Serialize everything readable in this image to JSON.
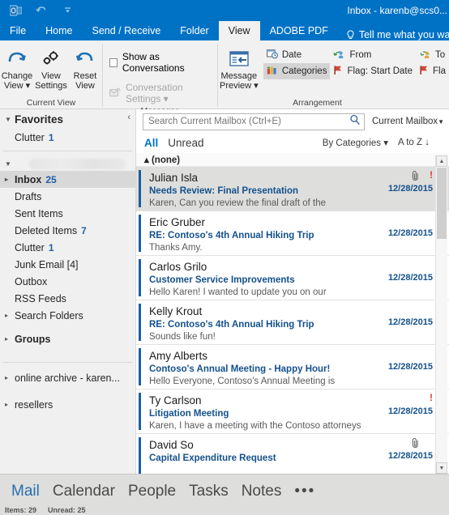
{
  "window": {
    "title": "Inbox - karenb@scs0...",
    "quick_access": [
      "outlook-logo-icon",
      "undo-icon",
      "customize-qat-icon"
    ]
  },
  "ribbon": {
    "tabs": [
      {
        "label": "File",
        "active": false
      },
      {
        "label": "Home",
        "active": false
      },
      {
        "label": "Send / Receive",
        "active": false
      },
      {
        "label": "Folder",
        "active": false
      },
      {
        "label": "View",
        "active": true
      },
      {
        "label": "ADOBE PDF",
        "active": false
      }
    ],
    "tell_me": "Tell me what you want to do",
    "groups": [
      {
        "name": "Current View",
        "label": "Current View",
        "buttons": [
          {
            "label_top": "Change",
            "label_bottom": "View ▾",
            "icon": "change-view-icon"
          },
          {
            "label_top": "View",
            "label_bottom": "Settings",
            "icon": "view-settings-icon"
          },
          {
            "label_top": "Reset",
            "label_bottom": "View",
            "icon": "reset-view-icon"
          }
        ]
      },
      {
        "name": "Messages",
        "label": "Messages",
        "checkbox": "Show as Conversations",
        "dropdown": "Conversation Settings ▾"
      },
      {
        "name": "Arrangement",
        "label": "Arrangement",
        "message_preview_top": "Message",
        "message_preview_bottom": "Preview ▾",
        "items": [
          {
            "label": "Date",
            "icon": "date-icon",
            "selected": false
          },
          {
            "label": "From",
            "icon": "from-icon",
            "selected": false
          },
          {
            "label": "To",
            "icon": "to-icon",
            "selected": false
          },
          {
            "label": "Categories",
            "icon": "categories-icon",
            "selected": true
          },
          {
            "label": "Flag: Start Date",
            "icon": "flag-icon",
            "selected": false
          },
          {
            "label": "Fla",
            "icon": "flag-icon",
            "selected": false
          }
        ]
      }
    ]
  },
  "sidebar": {
    "collapse_icon": "collapse-pane-icon",
    "favorites": {
      "label": "Favorites",
      "items": [
        {
          "label": "Clutter",
          "count": "1"
        }
      ]
    },
    "account_name_redacted": true,
    "folders": [
      {
        "label": "Inbox",
        "count": "25",
        "selected": true,
        "expandable": true
      },
      {
        "label": "Drafts",
        "count": "",
        "selected": false,
        "expandable": false
      },
      {
        "label": "Sent Items",
        "count": "",
        "selected": false,
        "expandable": false
      },
      {
        "label": "Deleted Items",
        "count": "7",
        "selected": false,
        "expandable": false
      },
      {
        "label": "Clutter",
        "count": "1",
        "selected": false,
        "expandable": false
      },
      {
        "label": "Junk Email [4]",
        "count": "",
        "selected": false,
        "expandable": false
      },
      {
        "label": "Outbox",
        "count": "",
        "selected": false,
        "expandable": false
      },
      {
        "label": "RSS Feeds",
        "count": "",
        "selected": false,
        "expandable": false
      },
      {
        "label": "Search Folders",
        "count": "",
        "selected": false,
        "expandable": true
      }
    ],
    "groups_label": "Groups",
    "other_stores": [
      {
        "label": "online archive - karen..."
      },
      {
        "label": "resellers"
      }
    ]
  },
  "search": {
    "placeholder": "Search Current Mailbox (Ctrl+E)",
    "value": "",
    "scope": "Current Mailbox",
    "icon": "search-icon"
  },
  "filter_bar": {
    "all": "All",
    "unread": "Unread",
    "arrange_by": "By Categories ▾",
    "sort": "A to Z ↓"
  },
  "group_header": "▴ (none)",
  "messages": [
    {
      "from": "Julian Isla",
      "subject": "Needs Review: Final Presentation",
      "preview": "Karen,  Can you review the final draft of the",
      "date": "12/28/2015",
      "selected": true,
      "attachment": true,
      "important": true
    },
    {
      "from": "Eric Gruber",
      "subject": "RE: Contoso's 4th Annual Hiking Trip",
      "preview": "Thanks Amy.",
      "date": "12/28/2015",
      "selected": false,
      "attachment": false,
      "important": false
    },
    {
      "from": "Carlos Grilo",
      "subject": "Customer Service Improvements",
      "preview": " Hello Karen!  I wanted to update you on our",
      "date": "12/28/2015",
      "selected": false,
      "attachment": false,
      "important": false
    },
    {
      "from": "Kelly Krout",
      "subject": "RE: Contoso's 4th Annual Hiking Trip",
      "preview": "Sounds like fun!",
      "date": "12/28/2015",
      "selected": false,
      "attachment": false,
      "important": false
    },
    {
      "from": "Amy Alberts",
      "subject": "Contoso's Annual Meeting - Happy Hour!",
      "preview": "Hello Everyone,  Contoso's Annual Meeting is",
      "date": "12/28/2015",
      "selected": false,
      "attachment": false,
      "important": false
    },
    {
      "from": "Ty Carlson",
      "subject": "Litigation Meeting",
      "preview": "Karen,  I have a meeting with the Contoso attorneys",
      "date": "12/28/2015",
      "selected": false,
      "attachment": false,
      "important": true
    },
    {
      "from": "David So",
      "subject": "Capital Expenditure Request",
      "preview": "",
      "date": "12/28/2015",
      "selected": false,
      "attachment": true,
      "important": false
    }
  ],
  "bottom_nav": {
    "items": [
      {
        "label": "Mail",
        "active": true
      },
      {
        "label": "Calendar",
        "active": false
      },
      {
        "label": "People",
        "active": false
      },
      {
        "label": "Tasks",
        "active": false
      },
      {
        "label": "Notes",
        "active": false
      }
    ],
    "more": "•••"
  },
  "status_bar": {
    "items": "Items: 29",
    "unread": "Unread: 25"
  },
  "colors": {
    "accent": "#0072c6",
    "subject": "#14518c",
    "important": "#e03c31",
    "unread_bar": "#1b5e9e"
  }
}
